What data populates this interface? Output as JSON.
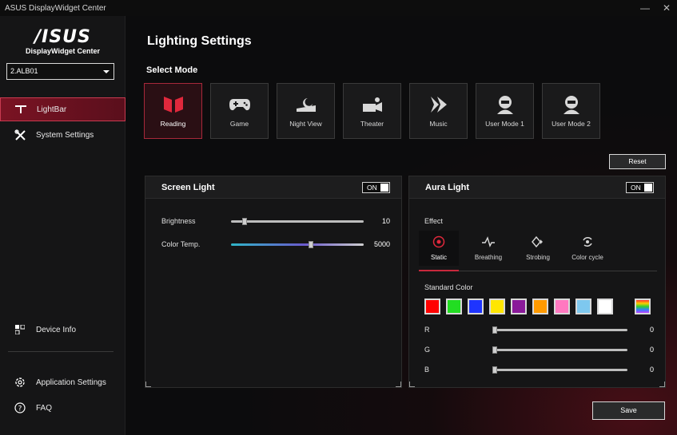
{
  "window": {
    "title": "ASUS DisplayWidget Center",
    "minimize_glyph": "—",
    "close_glyph": "✕"
  },
  "sidebar": {
    "logo": "/ISUS",
    "logo_sub": "DisplayWidget Center",
    "monitor_value": "2.ALB01",
    "items": [
      {
        "label": "LightBar",
        "icon": "lightbar-icon"
      },
      {
        "label": "System Settings",
        "icon": "tools-icon"
      },
      {
        "label": "Device Info",
        "icon": "device-info-icon"
      },
      {
        "label": "Application Settings",
        "icon": "gear-icon"
      },
      {
        "label": "FAQ",
        "icon": "help-icon"
      }
    ]
  },
  "main": {
    "title": "Lighting Settings",
    "select_mode_label": "Select Mode",
    "modes": [
      {
        "label": "Reading",
        "active": true
      },
      {
        "label": "Game"
      },
      {
        "label": "Night View"
      },
      {
        "label": "Theater"
      },
      {
        "label": "Music"
      },
      {
        "label": "User Mode 1"
      },
      {
        "label": "User Mode 2"
      }
    ],
    "reset_label": "Reset",
    "save_label": "Save"
  },
  "screen_light": {
    "title": "Screen Light",
    "toggle": "ON",
    "brightness": {
      "label": "Brightness",
      "value": "10",
      "fraction": 0.1
    },
    "color_temp": {
      "label": "Color Temp.",
      "value": "5000",
      "fraction": 0.6
    }
  },
  "aura_light": {
    "title": "Aura Light",
    "toggle": "ON",
    "effect_label": "Effect",
    "effects": [
      {
        "label": "Static",
        "active": true
      },
      {
        "label": "Breathing"
      },
      {
        "label": "Strobing"
      },
      {
        "label": "Color cycle"
      }
    ],
    "standard_color_label": "Standard Color",
    "colors": [
      "#ff0000",
      "#22dd22",
      "#1e34ff",
      "#ffe600",
      "#8a1a9a",
      "#ff9a00",
      "#ff78c0",
      "#7ec8ef",
      "#ffffff"
    ],
    "rgb": [
      {
        "label": "R",
        "value": "0"
      },
      {
        "label": "G",
        "value": "0"
      },
      {
        "label": "B",
        "value": "0"
      }
    ]
  },
  "colors": {
    "accent": "#c8283c",
    "active_bg": "#7a1323"
  }
}
